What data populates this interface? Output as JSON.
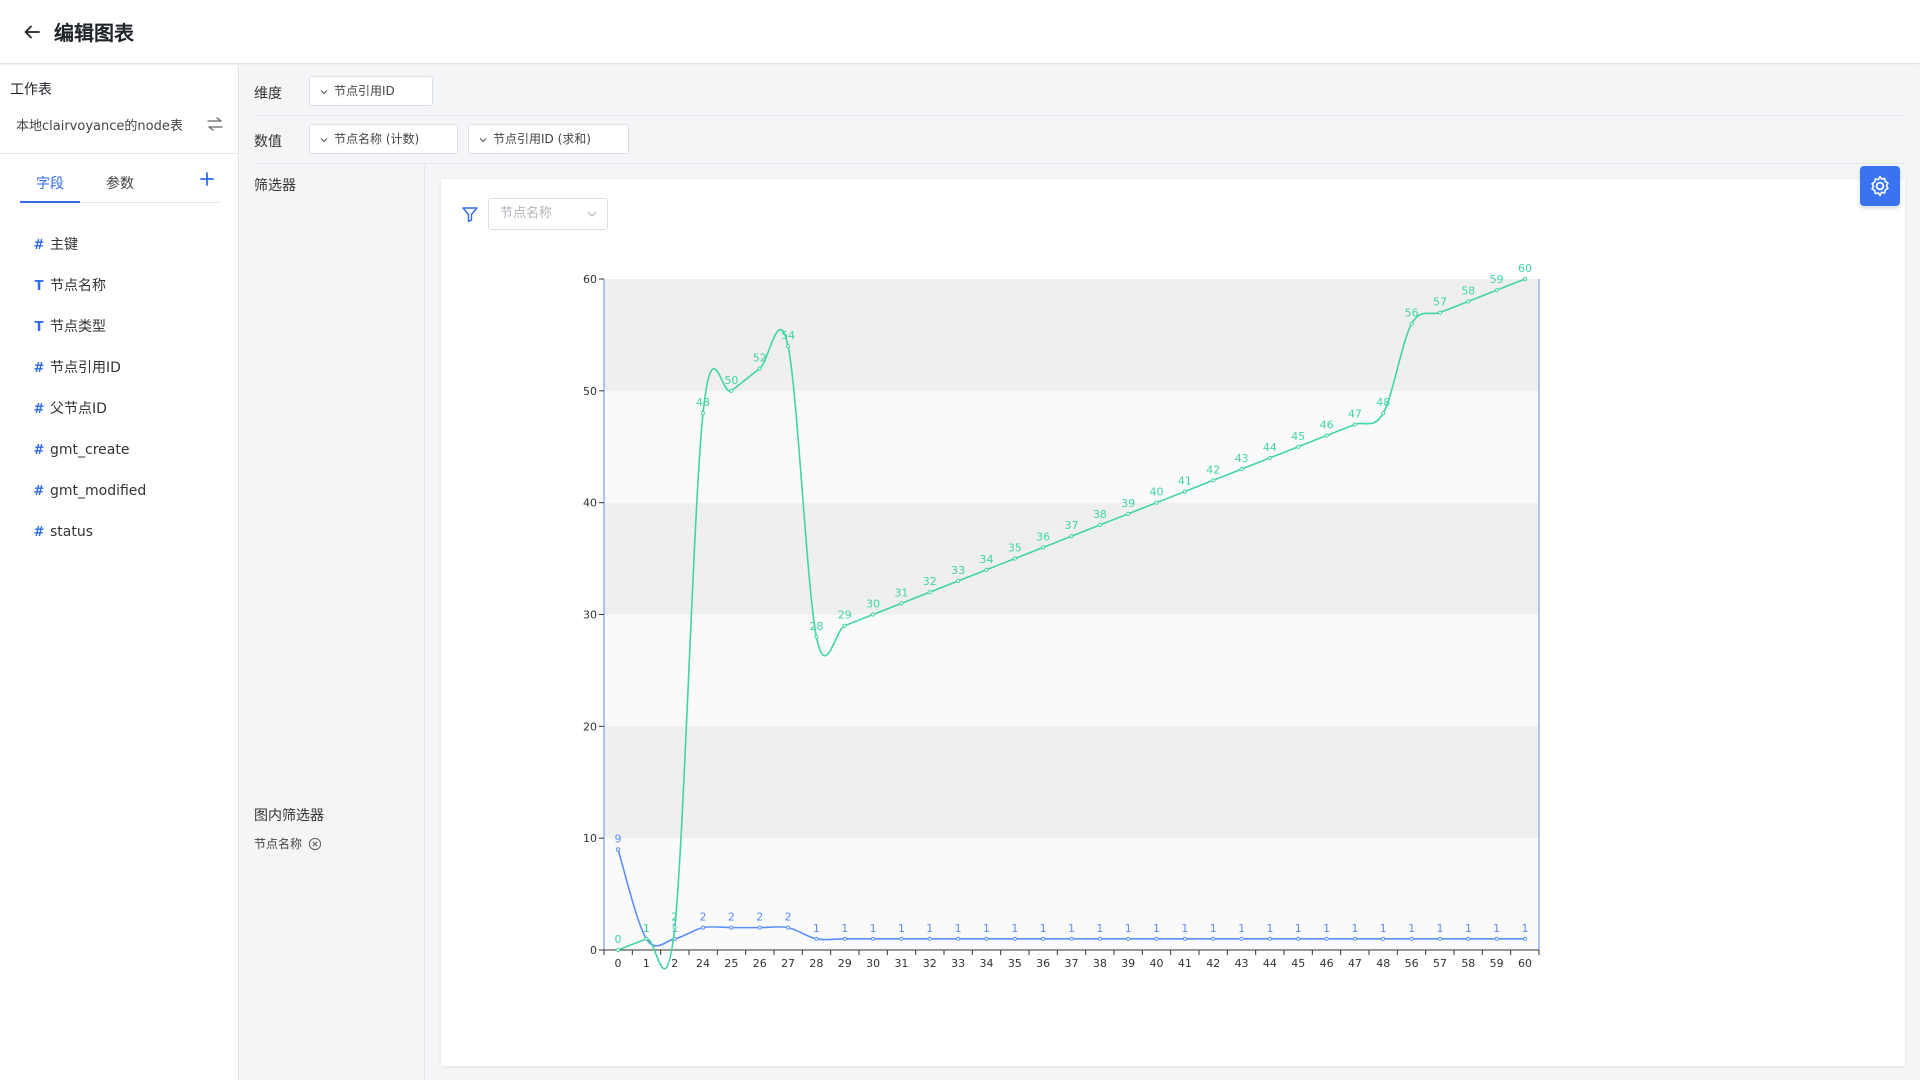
{
  "header": {
    "title": "编辑图表"
  },
  "sidebar": {
    "worksheet_label": "工作表",
    "worksheet_name": "本地clairvoyance的node表",
    "tabs": [
      {
        "label": "字段"
      },
      {
        "label": "参数"
      }
    ],
    "fields": [
      {
        "type": "#",
        "label": "主键"
      },
      {
        "type": "T",
        "label": "节点名称"
      },
      {
        "type": "T",
        "label": "节点类型"
      },
      {
        "type": "#",
        "label": "节点引用ID"
      },
      {
        "type": "#",
        "label": "父节点ID"
      },
      {
        "type": "#",
        "label": "gmt_create"
      },
      {
        "type": "#",
        "label": "gmt_modified"
      },
      {
        "type": "#",
        "label": "status"
      }
    ]
  },
  "config": {
    "dimension_label": "维度",
    "dimension_pill": "节点引用ID",
    "values_label": "数值",
    "value_pills": [
      "节点名称 (计数)",
      "节点引用ID (求和)"
    ],
    "filter_label": "筛选器",
    "inner_filter_label": "图内筛选器",
    "inner_filter_field": "节点名称"
  },
  "canvas": {
    "filter_placeholder": "节点名称"
  },
  "colors": {
    "accent": "#2f6bec",
    "series_count": "#5b8ff9",
    "series_sum": "#3fd6a0",
    "band": "#efefef"
  },
  "chart_data": {
    "type": "line",
    "x": [
      "0",
      "1",
      "2",
      "24",
      "25",
      "26",
      "27",
      "28",
      "29",
      "30",
      "31",
      "32",
      "33",
      "34",
      "35",
      "36",
      "37",
      "38",
      "39",
      "40",
      "41",
      "42",
      "43",
      "44",
      "45",
      "46",
      "47",
      "48",
      "56",
      "57",
      "58",
      "59",
      "60"
    ],
    "series": [
      {
        "values": [
          9,
          1,
          1,
          2,
          2,
          2,
          2,
          1,
          1,
          1,
          1,
          1,
          1,
          1,
          1,
          1,
          1,
          1,
          1,
          1,
          1,
          1,
          1,
          1,
          1,
          1,
          1,
          1,
          1,
          1,
          1,
          1,
          1
        ]
      },
      {
        "values": [
          0,
          1,
          2,
          48,
          50,
          52,
          54,
          28,
          29,
          30,
          31,
          32,
          33,
          34,
          35,
          36,
          37,
          38,
          39,
          40,
          41,
          42,
          43,
          44,
          45,
          46,
          47,
          48,
          56,
          57,
          58,
          59,
          60
        ]
      }
    ],
    "ylim": [
      0,
      60
    ],
    "yticks": [
      "0",
      "10",
      "20",
      "30",
      "40",
      "50",
      "60"
    ],
    "grid": "alternating-bands",
    "smooth": true
  }
}
